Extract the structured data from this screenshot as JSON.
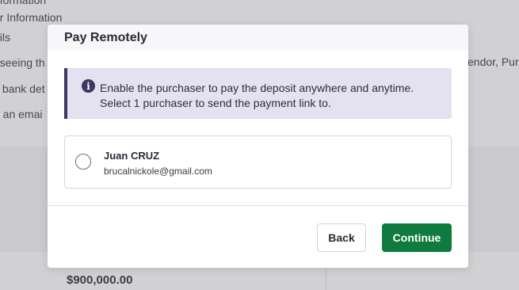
{
  "background": {
    "lines": [
      "nformation",
      "er Information",
      "ails",
      "t seeing th",
      "s bank det",
      "d an emai"
    ],
    "right_text": "endor, Purc",
    "amount": "$900,000.00"
  },
  "modal": {
    "title": "Pay Remotely",
    "info_icon": "info-icon",
    "info_line1": "Enable the purchaser to pay the deposit anywhere and anytime.",
    "info_line2": "Select 1 purchaser to send the payment link to.",
    "option": {
      "name": "Juan CRUZ",
      "email": "brucalnickole@gmail.com",
      "selected": false
    },
    "back_label": "Back",
    "continue_label": "Continue"
  },
  "colors": {
    "primary": "#0f7b3e",
    "banner_bg": "#e4e1f0",
    "banner_accent": "#3d3761"
  }
}
